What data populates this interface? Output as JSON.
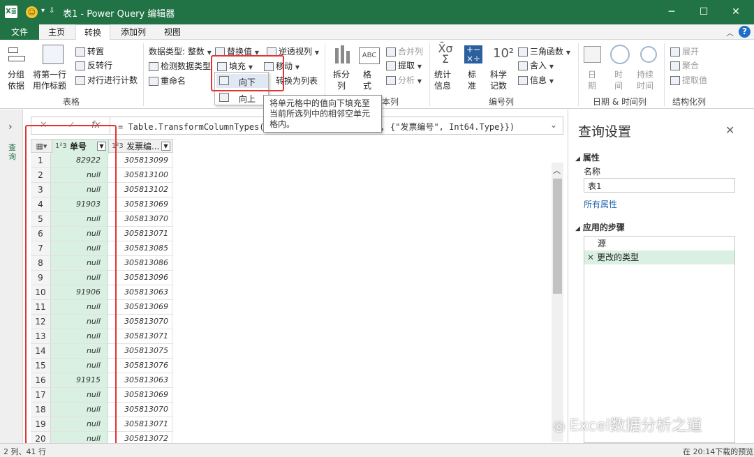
{
  "titlebar": {
    "app_badge": "X≣",
    "title": "表1 - Power Query 编辑器",
    "minimize": "─",
    "maximize": "☐",
    "close": "✕"
  },
  "tabs": [
    "文件",
    "主页",
    "转换",
    "添加列",
    "视图"
  ],
  "ribbon": {
    "groups": {
      "table": "表格",
      "number": "编号列",
      "datetime": "日期 & 时间列",
      "struct": "结构化列"
    },
    "group_by": "分组\n依据",
    "first_row": "将第一行\n用作标题",
    "transpose": "转置",
    "reverse": "反转行",
    "count_rows": "对行进行计数",
    "datatype": "数据类型: 整数",
    "detect": "检测数据类型",
    "rename": "重命名",
    "replace": "替换值",
    "fill": "填充",
    "unpivot": "逆透视列",
    "move": "移动",
    "to_list": "转换为列表",
    "split": "拆分\n列",
    "format": "格\n式",
    "merge": "合并列",
    "extract": "提取",
    "parse": "分析",
    "partial_group": "文本列",
    "stats": "统计\n信息",
    "standard": "标\n准",
    "scientific": "科学\n记数",
    "trig": "三角函数",
    "round": "舍入",
    "info": "信息",
    "date": "日\n期",
    "time": "时\n间",
    "duration": "持续\n时间",
    "expand": "展开",
    "aggregate": "聚合",
    "extract_values": "提取值",
    "fill_down": "向下",
    "fill_up": "向上",
    "tooltip": "将单元格中的值向下填充至当前所选列中的相邻空单元格内。"
  },
  "queries_label": "查询",
  "formula": {
    "fx": "fx",
    "text": "= Table.TransformColumnTypes(源,{{\"单号\", Int64.Type}, {\"发票编号\", Int64.Type}})"
  },
  "table": {
    "columns": [
      {
        "type": "1²3",
        "name": "单号"
      },
      {
        "type": "1²3",
        "name": "发票编..."
      }
    ],
    "rows": [
      [
        "1",
        "82922",
        "305813099"
      ],
      [
        "2",
        "null",
        "305813100"
      ],
      [
        "3",
        "null",
        "305813102"
      ],
      [
        "4",
        "91903",
        "305813069"
      ],
      [
        "5",
        "null",
        "305813070"
      ],
      [
        "6",
        "null",
        "305813071"
      ],
      [
        "7",
        "null",
        "305813085"
      ],
      [
        "8",
        "null",
        "305813086"
      ],
      [
        "9",
        "null",
        "305813096"
      ],
      [
        "10",
        "91906",
        "305813063"
      ],
      [
        "11",
        "null",
        "305813069"
      ],
      [
        "12",
        "null",
        "305813070"
      ],
      [
        "13",
        "null",
        "305813071"
      ],
      [
        "14",
        "null",
        "305813075"
      ],
      [
        "15",
        "null",
        "305813076"
      ],
      [
        "16",
        "91915",
        "305813063"
      ],
      [
        "17",
        "null",
        "305813069"
      ],
      [
        "18",
        "null",
        "305813070"
      ],
      [
        "19",
        "null",
        "305813071"
      ],
      [
        "20",
        "null",
        "305813072"
      ]
    ]
  },
  "settings": {
    "title": "查询设置",
    "props_header": "属性",
    "name_label": "名称",
    "name_value": "表1",
    "all_props": "所有属性",
    "steps_header": "应用的步骤",
    "steps": [
      "源",
      "更改的类型"
    ]
  },
  "status": {
    "left": "2 列、41 行",
    "right": "在 20:14下载的预览"
  },
  "watermark": "Excel数据分析之道",
  "colors": {
    "excel_green": "#217346",
    "selected_col": "#d9f0e2",
    "highlight": "#e3342f"
  }
}
